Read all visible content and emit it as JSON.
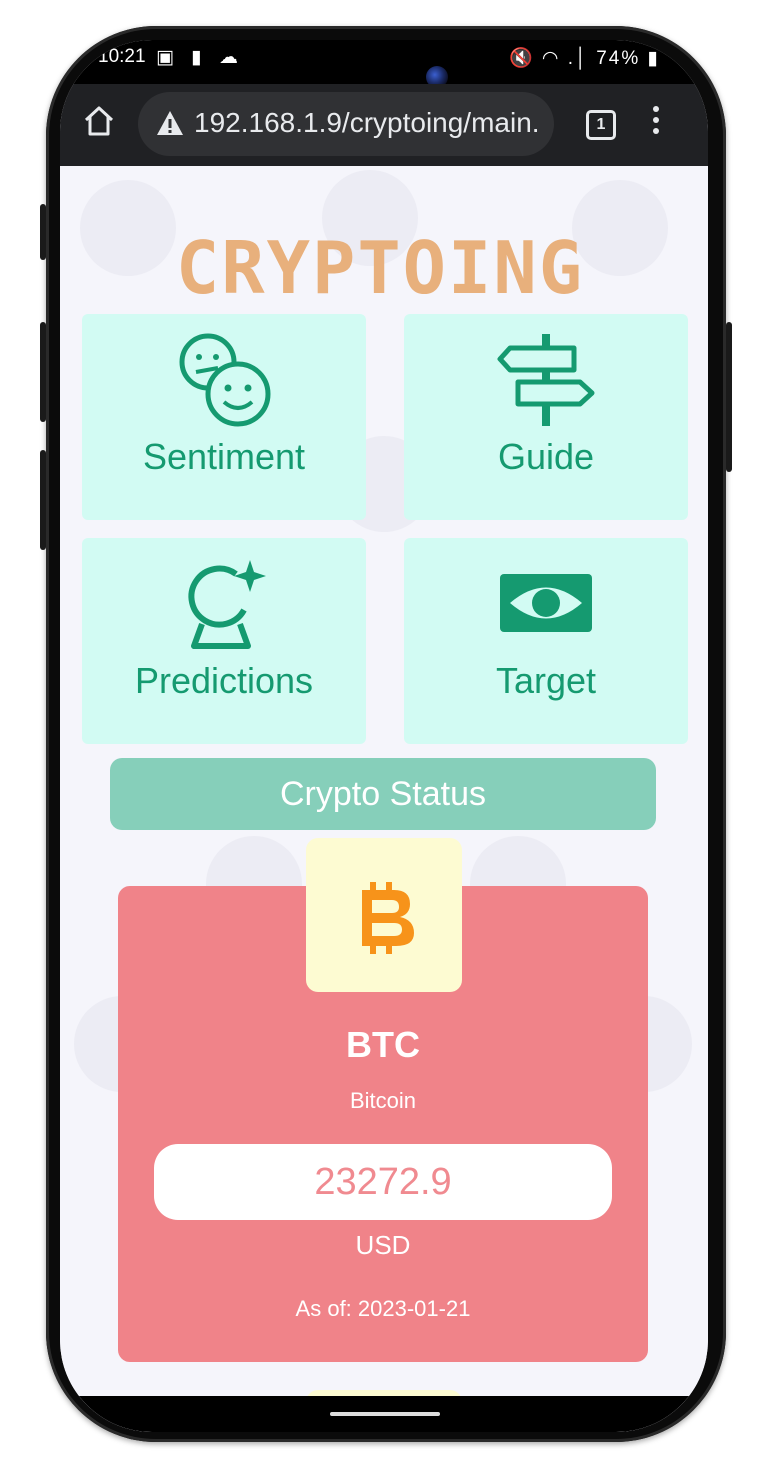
{
  "statusbar": {
    "time": "10:21",
    "left_icons": "▣ ▮ ☁",
    "right_icons": "🔇 ◠ .│",
    "battery": "74%"
  },
  "browser": {
    "url": "192.168.1.9/cryptoing/main.",
    "tab_count": "1"
  },
  "app": {
    "logo": "CRYPTOING",
    "tiles": [
      {
        "label": "Sentiment",
        "icon": "faces-icon"
      },
      {
        "label": "Guide",
        "icon": "signpost-icon"
      },
      {
        "label": "Predictions",
        "icon": "crystal-ball-icon"
      },
      {
        "label": "Target",
        "icon": "money-icon"
      }
    ],
    "section_title": "Crypto Status",
    "coin": {
      "symbol": "BTC",
      "name": "Bitcoin",
      "price": "23272.9",
      "currency": "USD",
      "as_of": "As of: 2023-01-21",
      "icon": "bitcoin-icon"
    }
  },
  "colors": {
    "accent_teal": "#159a70",
    "tile_bg": "#d2fbf3",
    "card_red": "#f08389",
    "logo": "#e8b07c",
    "bitcoin_orange": "#f7931a"
  }
}
